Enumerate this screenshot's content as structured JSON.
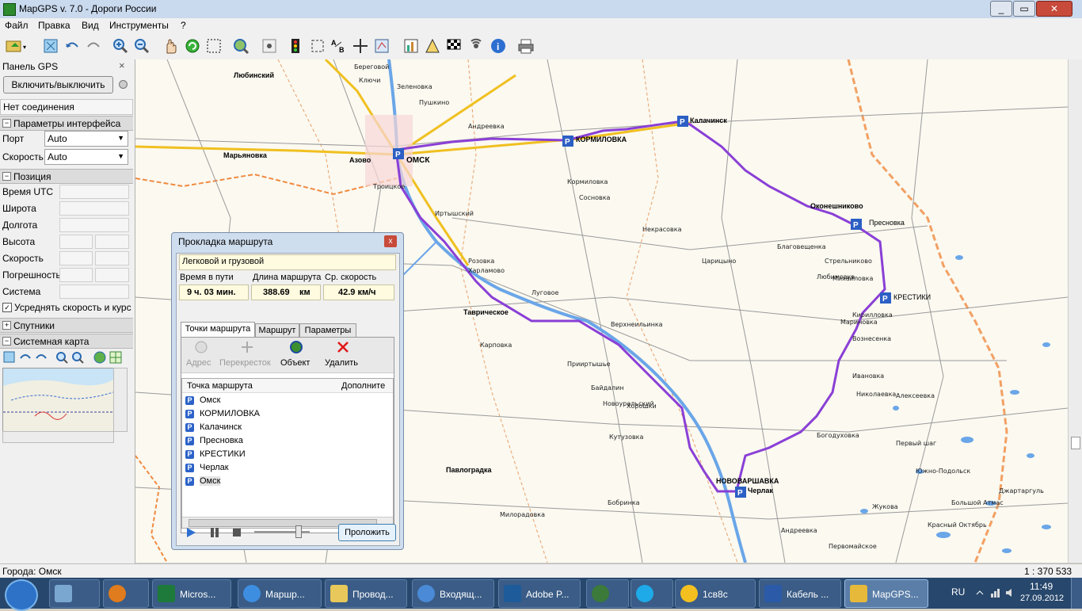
{
  "window": {
    "title": "MapGPS v. 7.0 - Дороги России",
    "btn_min": "_",
    "btn_max": "▭",
    "btn_close": "✕"
  },
  "menu": [
    "Файл",
    "Правка",
    "Вид",
    "Инструменты",
    "?"
  ],
  "gps_panel": {
    "title": "Панель GPS",
    "close": "×",
    "toggle_label": "Включить/выключить",
    "connection_status": "Нет соединения",
    "interface_section": "Параметры интерфейса",
    "port_label": "Порт",
    "port_value": "Auto",
    "speed_label": "Скорость",
    "speed_value": "Auto",
    "position_section": "Позиция",
    "fields": [
      "Время UTC",
      "Широта",
      "Долгота",
      "Высота",
      "Скорость",
      "Погрешность",
      "Система"
    ],
    "average_label": "Усреднять скорость и курс",
    "satellites_section": "Спутники",
    "sysmap_section": "Системная карта"
  },
  "map": {
    "cities": [
      {
        "name": "ОМСК"
      },
      {
        "name": "КОРМИЛОВКА"
      },
      {
        "name": "Калачинск"
      },
      {
        "name": "Оконешниково"
      },
      {
        "name": "Пресновка"
      },
      {
        "name": "КРЕСТИКИ"
      },
      {
        "name": "НОВОВАРШАВКА"
      },
      {
        "name": "Черлак"
      },
      {
        "name": "Таврическое"
      },
      {
        "name": "Павлоградка"
      },
      {
        "name": "Марьяновка"
      },
      {
        "name": "Любинский"
      },
      {
        "name": "Азовo"
      }
    ],
    "places": [
      "Береговой",
      "Ключи",
      "Зеленовка",
      "Пушкино",
      "Андреевка",
      "Кормиловка",
      "Сосновка",
      "Некрасовка",
      "Царицыно",
      "Благовещенка",
      "Стрельниково",
      "Михайловка",
      "Любимовка",
      "Кирилловка",
      "Мариновка",
      "Вознесенка",
      "Ивановка",
      "Николаевка",
      "Троицкое",
      "Иртышский",
      "Розовка",
      "Харламово",
      "Луговое",
      "Верхнеильинка",
      "Карповка",
      "Прииртышье",
      "Байдалин",
      "Новоуральский",
      "Хорошки",
      "Кутузовка",
      "Бобринка",
      "Милорадовка",
      "Богодуховка",
      "Алексеевка",
      "Южно-Подольск",
      "Джартаргуль",
      "Жукова",
      "Первомайское",
      "Андреевка",
      "Красный Октябрь",
      "Большой Атмас",
      "Первый шаг"
    ],
    "scale_text": "1 : 370 533"
  },
  "route_dialog": {
    "title": "Прокладка маршрута",
    "close": "x",
    "vehicle_type": "Легковой и грузовой",
    "col_time": "Время в пути",
    "col_length": "Длина маршрута",
    "col_speed": "Ср. скорость",
    "time_value": "9 ч. 03 мин.",
    "length_value": "388.69",
    "length_unit": "км",
    "speed_value": "42.9 км/ч",
    "tabs": [
      "Точки маршрута",
      "Маршрут",
      "Параметры"
    ],
    "tools": [
      "Адрес",
      "Перекресток",
      "Объект",
      "Удалить"
    ],
    "list_header": "Точка маршрута",
    "list_header2": "Дополните",
    "points": [
      "Омск",
      "КОРМИЛОВКА",
      "Калачинск",
      "Пресновка",
      "КРЕСТИКИ",
      "Черлак",
      "Омск"
    ],
    "go_button": "Проложить"
  },
  "status": {
    "left": "Города: Омск",
    "right": "1 : 370 533"
  },
  "taskbar": {
    "items": [
      "Micros...",
      "Маршр...",
      "Провод...",
      "Входящ...",
      "Adobe P...",
      "1св8с",
      "Кабель ...",
      "MapGPS..."
    ],
    "lang": "RU",
    "time": "11:49",
    "date": "27.09.2012"
  },
  "colors": {
    "route": "#8a3fd6",
    "main_road": "#f0c020",
    "border": "#f08a40",
    "water": "#6aa6e8"
  }
}
